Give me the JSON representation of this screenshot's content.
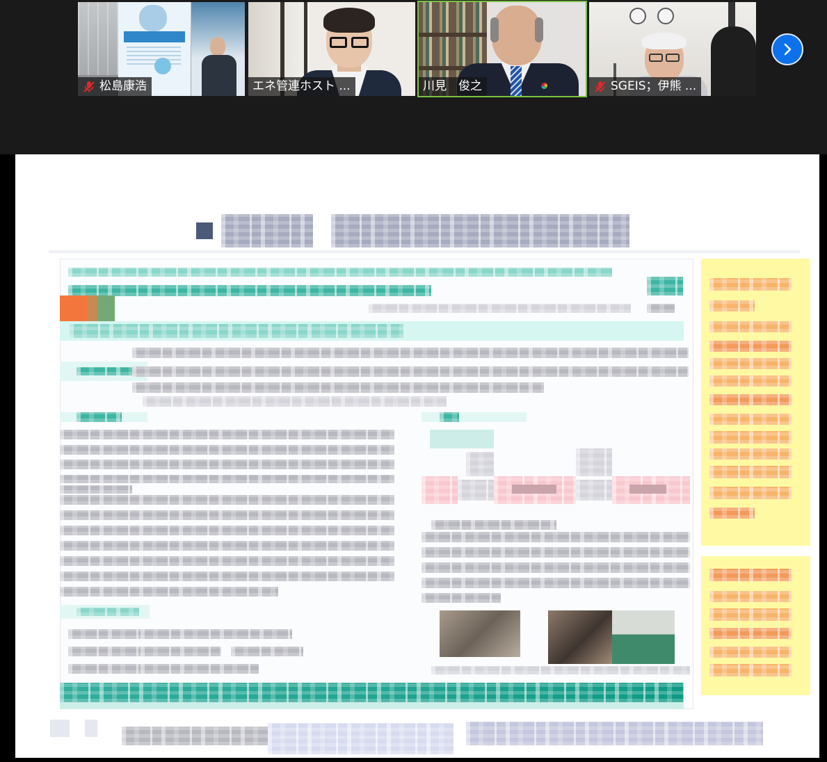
{
  "participants": [
    {
      "name": "松島康浩",
      "muted": true,
      "active_speaker": false
    },
    {
      "name": "エネ管連ホスト ...",
      "muted": false,
      "active_speaker": false
    },
    {
      "name": "川見　俊之",
      "muted": false,
      "active_speaker": true
    },
    {
      "name": "SGEIS；伊熊 ...",
      "muted": true,
      "active_speaker": false
    }
  ],
  "icons": {
    "muted": "mic-muted-icon",
    "next_page": "chevron-right-icon"
  },
  "colors": {
    "strip_background": "#1a1a1a",
    "active_speaker_border": "#7cc242",
    "nav_button": "#0e71eb",
    "muted_icon": "#e0282e"
  }
}
